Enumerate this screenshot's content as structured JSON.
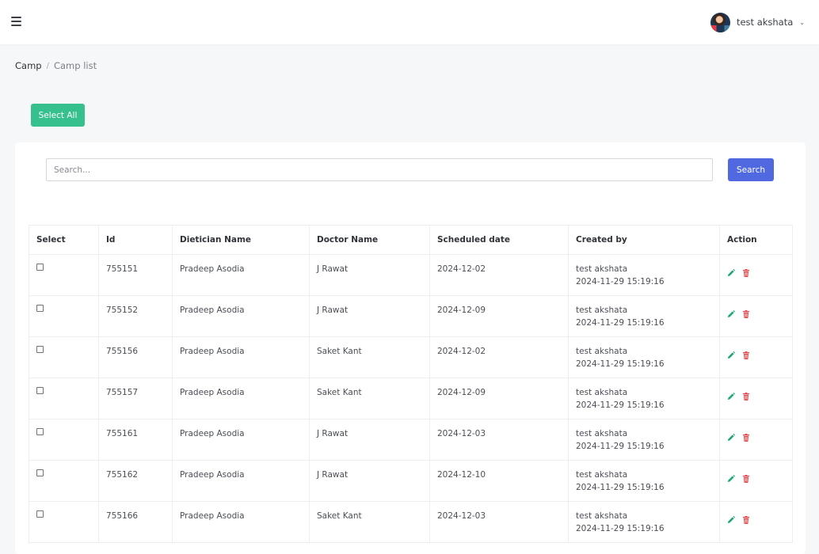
{
  "header": {
    "user_name": "test akshata",
    "caret": "⌄"
  },
  "breadcrumb": {
    "root": "Camp",
    "separator": "/",
    "current": "Camp list"
  },
  "toolbar": {
    "select_all_label": "Select All"
  },
  "search": {
    "placeholder": "Search...",
    "value": "",
    "button_label": "Search"
  },
  "table": {
    "columns": [
      "Select",
      "Id",
      "Dietician Name",
      "Doctor Name",
      "Scheduled date",
      "Created by",
      "Action"
    ],
    "rows": [
      {
        "id": "755151",
        "dietician": "Pradeep Asodia",
        "doctor": "J Rawat",
        "scheduled": "2024-12-02",
        "created_by": "test akshata",
        "created_at": "2024-11-29 15:19:16"
      },
      {
        "id": "755152",
        "dietician": "Pradeep Asodia",
        "doctor": "J Rawat",
        "scheduled": "2024-12-09",
        "created_by": "test akshata",
        "created_at": "2024-11-29 15:19:16"
      },
      {
        "id": "755156",
        "dietician": "Pradeep Asodia",
        "doctor": "Saket Kant",
        "scheduled": "2024-12-02",
        "created_by": "test akshata",
        "created_at": "2024-11-29 15:19:16"
      },
      {
        "id": "755157",
        "dietician": "Pradeep Asodia",
        "doctor": "Saket Kant",
        "scheduled": "2024-12-09",
        "created_by": "test akshata",
        "created_at": "2024-11-29 15:19:16"
      },
      {
        "id": "755161",
        "dietician": "Pradeep Asodia",
        "doctor": "J Rawat",
        "scheduled": "2024-12-03",
        "created_by": "test akshata",
        "created_at": "2024-11-29 15:19:16"
      },
      {
        "id": "755162",
        "dietician": "Pradeep Asodia",
        "doctor": "J Rawat",
        "scheduled": "2024-12-10",
        "created_by": "test akshata",
        "created_at": "2024-11-29 15:19:16"
      },
      {
        "id": "755166",
        "dietician": "Pradeep Asodia",
        "doctor": "Saket Kant",
        "scheduled": "2024-12-03",
        "created_by": "test akshata",
        "created_at": "2024-11-29 15:19:16"
      }
    ]
  },
  "icons": {
    "menu": "hamburger-menu-icon",
    "edit": "pencil-icon",
    "delete": "trash-icon"
  },
  "colors": {
    "select_all_bg": "#35c08e",
    "search_button_bg": "#5069e0",
    "edit_icon": "#1fa872",
    "delete_icon": "#e5484d"
  }
}
